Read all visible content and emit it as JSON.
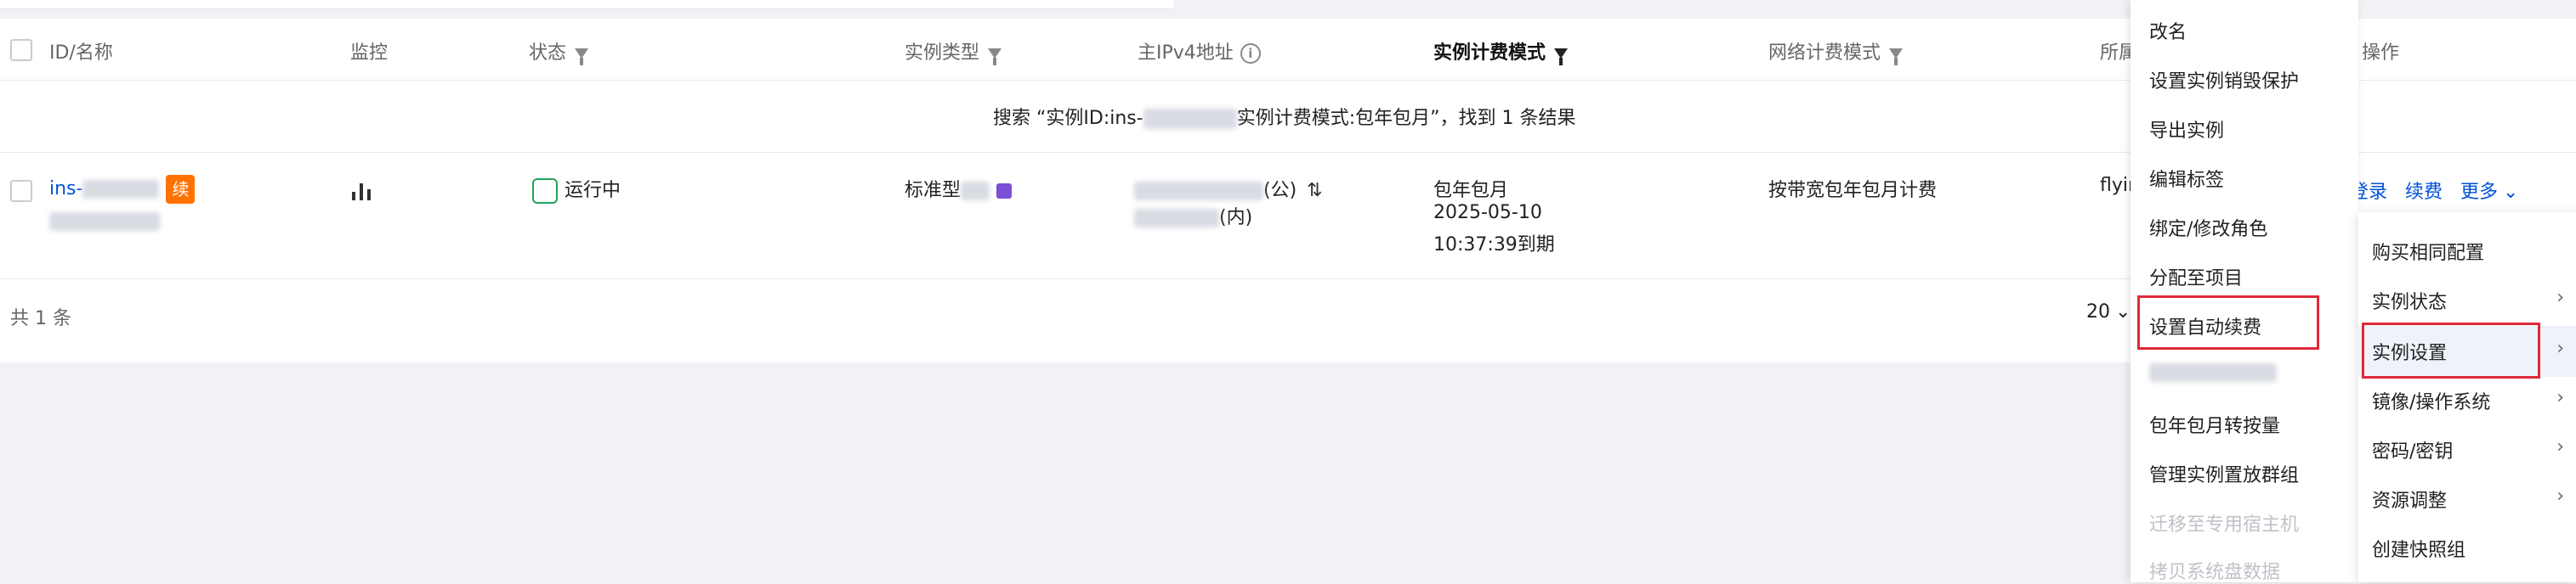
{
  "table": {
    "headers": {
      "id_name": "ID/名称",
      "monitor": "监控",
      "status": "状态",
      "instance_type": "实例类型",
      "ipv4": "主IPv4地址",
      "billing_mode": "实例计费模式",
      "network_billing": "网络计费模式",
      "project": "所属",
      "operation": "操作"
    },
    "search_result": {
      "prefix": "搜索 “实例ID:ins-",
      "suffix": "实例计费模式:包年包月”，找到 1 条结果"
    },
    "row": {
      "id_prefix": "ins-",
      "renew_badge": "续",
      "status": "运行中",
      "instance_type": "标准型",
      "ip_public_suffix": "(公)",
      "ip_private_suffix": "(内)",
      "billing_line1": "包年包月",
      "billing_line2": "2025-05-10",
      "billing_line3": "10:37:39到期",
      "network_billing": "按带宽包年包月计费",
      "project": "flyir",
      "actions": {
        "login": "登录",
        "renew": "续费",
        "more": "更多"
      }
    },
    "footer": {
      "total": "共 1 条",
      "page_size": "20"
    }
  },
  "menu_settings": {
    "items": [
      "改名",
      "设置实例销毁保护",
      "导出实例",
      "编辑标签",
      "绑定/修改角色",
      "分配至项目",
      "设置自动续费",
      "",
      "包年包月转按量",
      "管理实例置放群组",
      "迁移至专用宿主机",
      "拷贝系统盘数据"
    ]
  },
  "menu_more": {
    "items": [
      "购买相同配置",
      "实例状态",
      "实例设置",
      "镜像/操作系统",
      "密码/密钥",
      "资源调整",
      "创建快照组"
    ]
  },
  "colors": {
    "link": "#0052d9",
    "badge": "#ff7200",
    "status_green": "#21a55a",
    "highlight_red": "#e0283a",
    "disabled": "#bfc2c8"
  }
}
